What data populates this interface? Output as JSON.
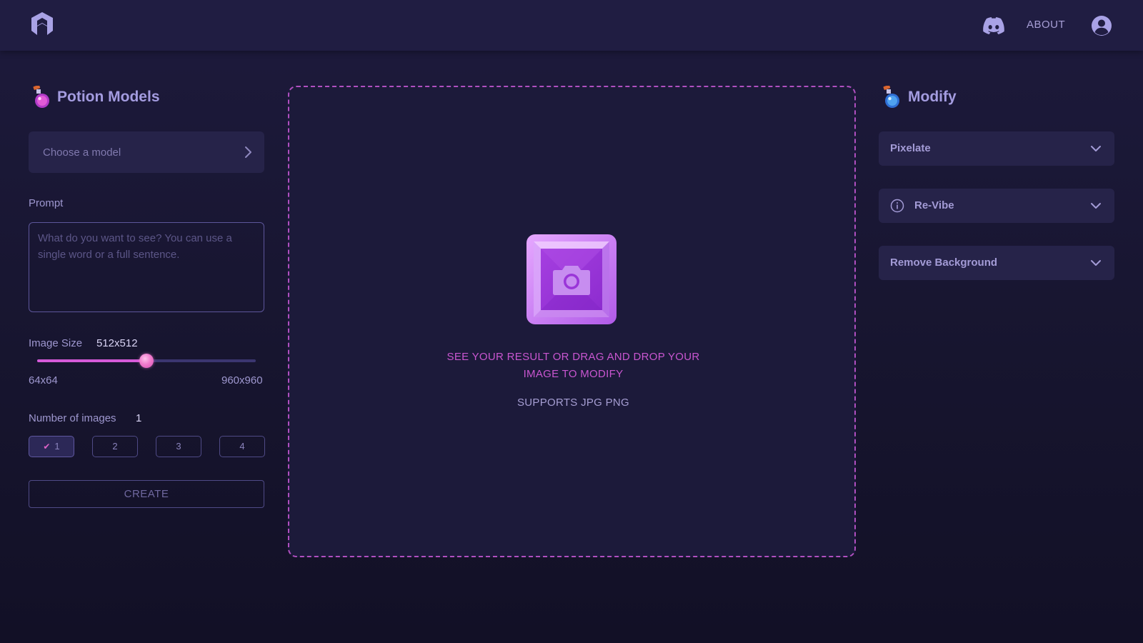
{
  "header": {
    "about_label": "ABOUT",
    "icons": [
      "logo-icon",
      "discord-icon",
      "user-icon"
    ]
  },
  "left_panel": {
    "title": "Potion Models",
    "model_select_placeholder": "Choose a model",
    "prompt_label": "Prompt",
    "prompt_placeholder": "What do you want to see? You can use a single word or a full sentence.",
    "prompt_value": "",
    "image_size": {
      "label": "Image Size",
      "value": "512x512",
      "min_label": "64x64",
      "max_label": "960x960",
      "fraction": 0.5
    },
    "number_of_images": {
      "label": "Number of images",
      "value": "1",
      "options": [
        "1",
        "2",
        "3",
        "4"
      ],
      "selected_index": 0
    },
    "create_label": "CREATE"
  },
  "dropzone": {
    "line1": "SEE YOUR RESULT OR DRAG AND DROP YOUR",
    "line2": "IMAGE TO MODIFY",
    "supports": "SUPPORTS JPG PNG"
  },
  "right_panel": {
    "title": "Modify",
    "items": [
      {
        "label": "Pixelate",
        "info_icon": false
      },
      {
        "label": "Re-Vibe",
        "info_icon": true
      },
      {
        "label": "Remove Background",
        "info_icon": false
      }
    ]
  },
  "colors": {
    "accent": "#d55ad8",
    "background": "#1d1a3c",
    "panel": "#262349",
    "text": "#9a93c9"
  }
}
